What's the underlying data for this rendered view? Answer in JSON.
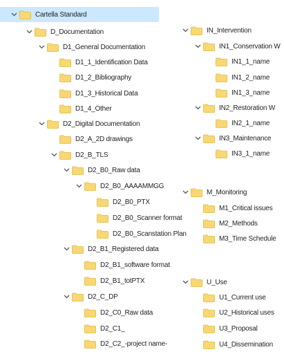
{
  "colors": {
    "selection": "#cce8ff",
    "folder": "#f8d775",
    "folder_shade": "#e2b93b",
    "chevron": "#555555"
  },
  "icons": {
    "expanded": "chevron-down-icon",
    "folder": "folder-icon"
  },
  "root": {
    "label": "Cartella Standard",
    "expanded": true,
    "selected": true
  },
  "left_tree": [
    {
      "label": "D_Documentation",
      "expanded": true
    },
    {
      "label": "D1_General Documentation",
      "expanded": true
    },
    {
      "label": "D1_1_Identification Data",
      "expanded": false
    },
    {
      "label": "D1_2_Bibliography",
      "expanded": false
    },
    {
      "label": "D1_3_Historical Data",
      "expanded": false
    },
    {
      "label": "D1_4_Other",
      "expanded": false
    },
    {
      "label": "D2_Digital Documentation",
      "expanded": true
    },
    {
      "label": "D2_A_2D drawings",
      "expanded": false
    },
    {
      "label": "D2_B_TLS",
      "expanded": true
    },
    {
      "label": "D2_B0_Raw data",
      "expanded": true
    },
    {
      "label": "D2_B0_AAAAMMGG",
      "expanded": true
    },
    {
      "label": "D2_B0_PTX",
      "expanded": false
    },
    {
      "label": "D2_B0_Scanner format",
      "expanded": false
    },
    {
      "label": "D2_B0_Scanstation Plan",
      "expanded": false
    },
    {
      "label": "D2_B1_Registered data",
      "expanded": true
    },
    {
      "label": "D2_B1_software format",
      "expanded": false
    },
    {
      "label": "D2_B1_totPTX",
      "expanded": false
    },
    {
      "label": "D2_C_DP",
      "expanded": true
    },
    {
      "label": "D2_C0_Raw data",
      "expanded": false
    },
    {
      "label": "D2_C1_",
      "expanded": false
    },
    {
      "label": "D2_C2_-project name-",
      "expanded": false
    }
  ],
  "right_tree": [
    {
      "label": "IN_Intervention",
      "expanded": true
    },
    {
      "label": "IN1_Conservation W",
      "expanded": true
    },
    {
      "label": "IN1_1_name",
      "expanded": false
    },
    {
      "label": "IN1_2_name",
      "expanded": false
    },
    {
      "label": "IN1_3_name",
      "expanded": false
    },
    {
      "label": "IN2_Restoration W",
      "expanded": true
    },
    {
      "label": "IN2_1_name",
      "expanded": false
    },
    {
      "label": "IN3_Maintenance",
      "expanded": true
    },
    {
      "label": "IN3_1_name",
      "expanded": false
    },
    {
      "label": "M_Monitoring",
      "expanded": true
    },
    {
      "label": "M1_Critical issues",
      "expanded": false
    },
    {
      "label": "M2_Methods",
      "expanded": false
    },
    {
      "label": "M3_Time Schedule",
      "expanded": false
    },
    {
      "label": "U_Use",
      "expanded": true
    },
    {
      "label": "U1_Current use",
      "expanded": false
    },
    {
      "label": "U2_Historical uses",
      "expanded": false
    },
    {
      "label": "U3_Proposal",
      "expanded": false
    },
    {
      "label": "U4_Dissemination",
      "expanded": false
    }
  ]
}
